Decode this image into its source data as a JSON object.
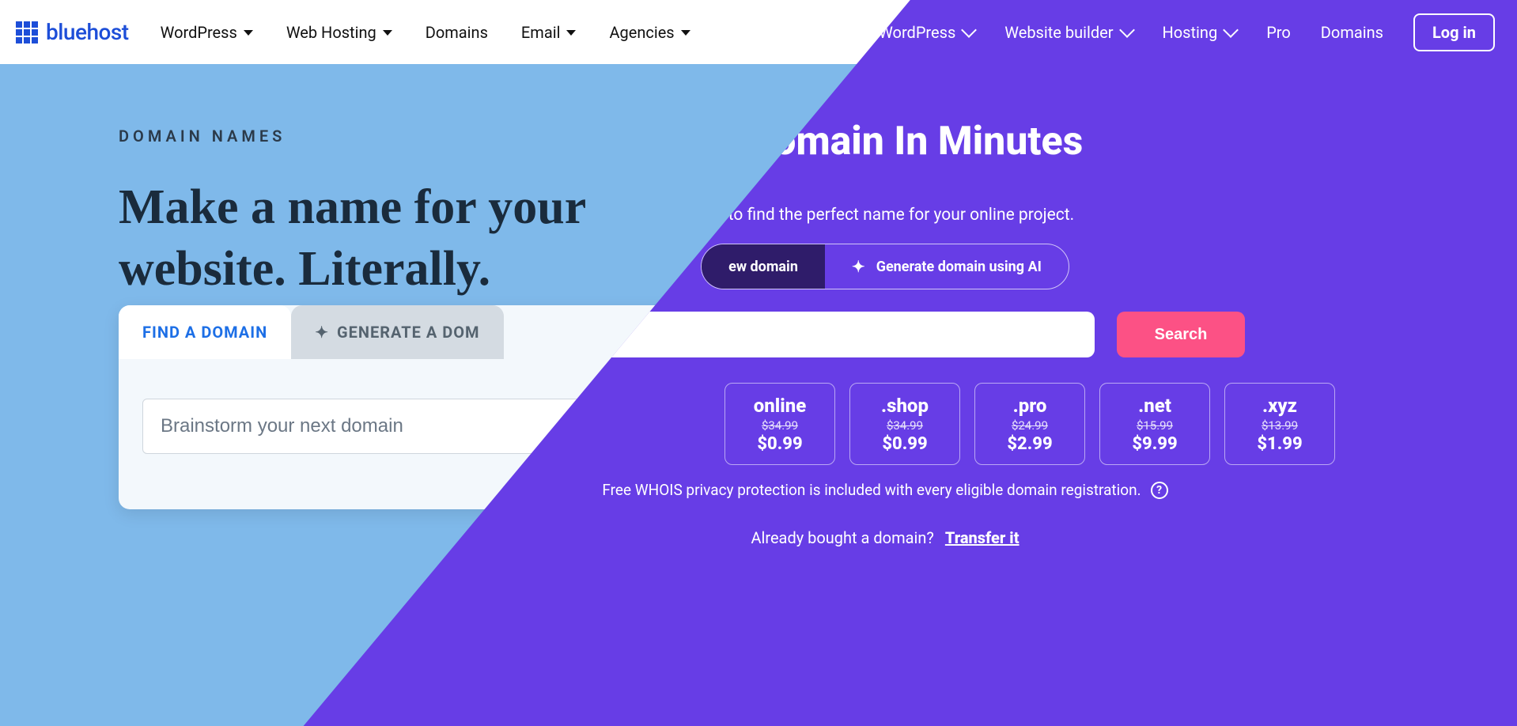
{
  "left": {
    "logo_text": "bluehost",
    "nav": {
      "wordpress": "WordPress",
      "webhosting": "Web Hosting",
      "domains": "Domains",
      "email": "Email",
      "agencies": "Agencies"
    },
    "eyebrow": "DOMAIN NAMES",
    "headline": "Make a name for your website. Literally.",
    "tabs": {
      "find": "FIND A DOMAIN",
      "generate": "GENERATE A DOM"
    },
    "input_placeholder": "Brainstorm your next domain"
  },
  "right": {
    "nav": {
      "wordpress": "WordPress",
      "website_builder": "Website builder",
      "hosting": "Hosting",
      "pro": "Pro",
      "domains": "Domains"
    },
    "login": "Log in",
    "title": "y a Domain In Minutes",
    "subtitle": "tool to find the perfect name for your online project.",
    "pills": {
      "new_domain": "ew domain",
      "ai": "Generate domain using AI"
    },
    "search_btn": "Search",
    "tlds": [
      {
        "ext": "online",
        "old": "$34.99",
        "new": "$0.99"
      },
      {
        "ext": ".shop",
        "old": "$34.99",
        "new": "$0.99"
      },
      {
        "ext": ".pro",
        "old": "$24.99",
        "new": "$2.99"
      },
      {
        "ext": ".net",
        "old": "$15.99",
        "new": "$9.99"
      },
      {
        "ext": ".xyz",
        "old": "$13.99",
        "new": "$1.99"
      }
    ],
    "whois": "Free WHOIS privacy protection is included with every eligible domain registration.",
    "transfer_q": "Already bought a domain?",
    "transfer_link": "Transfer it"
  }
}
